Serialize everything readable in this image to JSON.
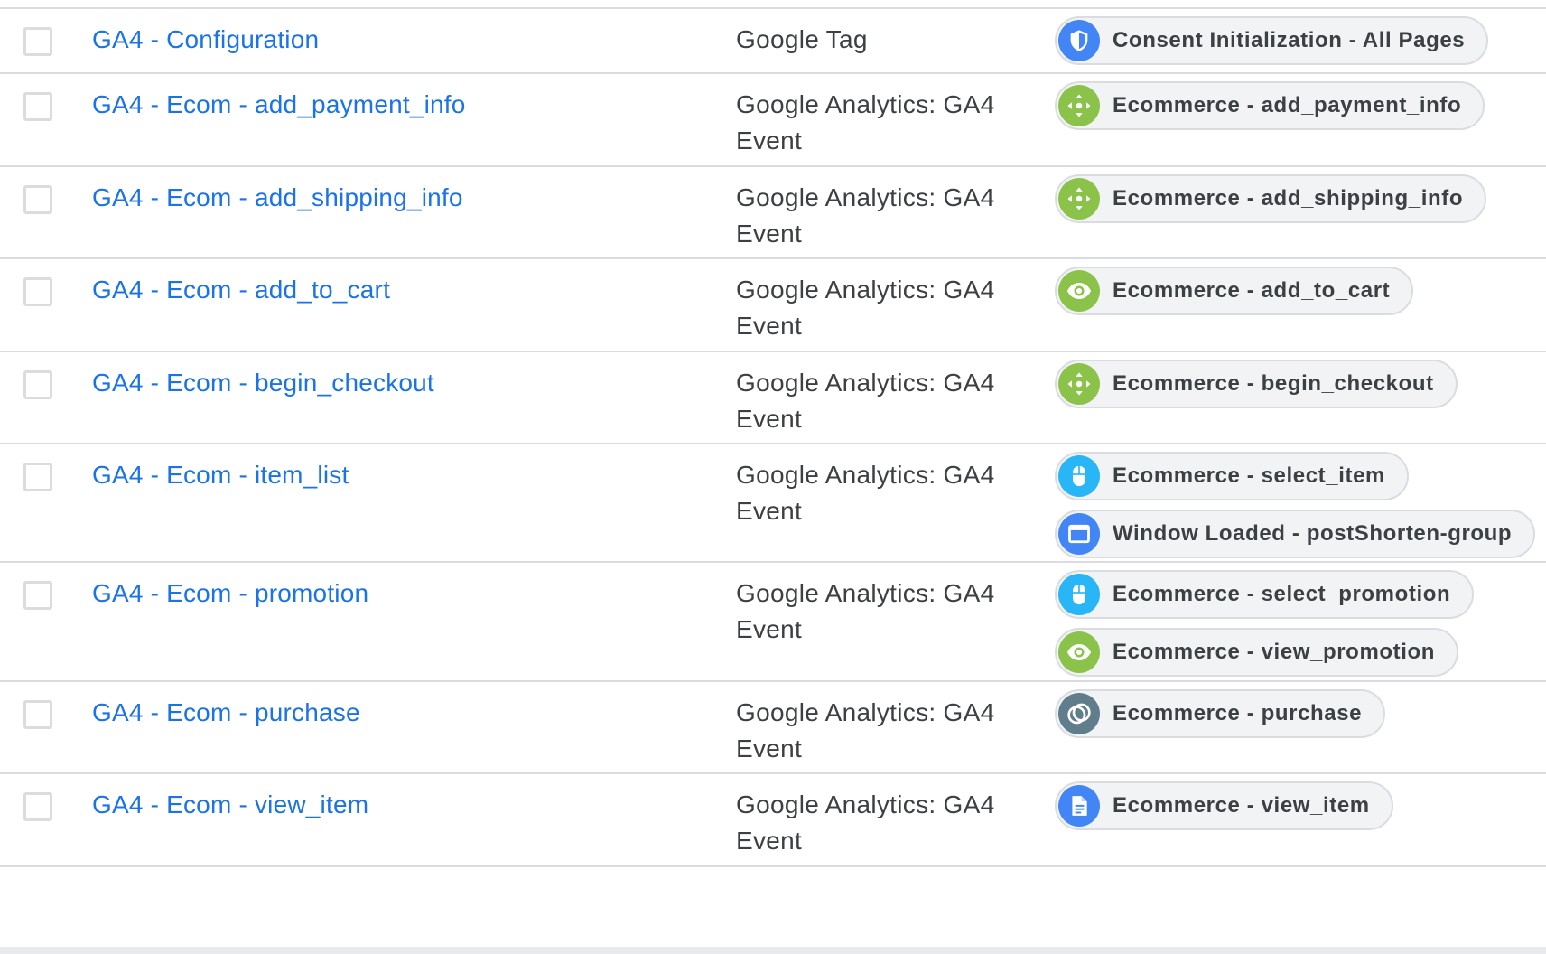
{
  "colors": {
    "link": "#1a73e8",
    "text": "#3c4043",
    "border": "#dadce0",
    "chip_bg": "#f1f3f4",
    "icon_blue": "#4285f4",
    "icon_green": "#8bc34a",
    "icon_lightblue": "#29b6f6",
    "icon_gray": "#607d8b"
  },
  "tags": [
    {
      "name": "GA4 - Configuration",
      "type": "Google Tag",
      "triggers": [
        {
          "label": "Consent Initialization - All Pages",
          "icon": "consent-shield-icon"
        }
      ]
    },
    {
      "name": "GA4 - Ecom - add_payment_info",
      "type": "Google Analytics: GA4 Event",
      "triggers": [
        {
          "label": "Ecommerce - add_payment_info",
          "icon": "custom-event-icon"
        }
      ]
    },
    {
      "name": "GA4 - Ecom - add_shipping_info",
      "type": "Google Analytics: GA4 Event",
      "triggers": [
        {
          "label": "Ecommerce - add_shipping_info",
          "icon": "custom-event-icon"
        }
      ]
    },
    {
      "name": "GA4 - Ecom - add_to_cart",
      "type": "Google Analytics: GA4 Event",
      "triggers": [
        {
          "label": "Ecommerce - add_to_cart",
          "icon": "eye-visibility-icon"
        }
      ]
    },
    {
      "name": "GA4 - Ecom - begin_checkout",
      "type": "Google Analytics: GA4 Event",
      "triggers": [
        {
          "label": "Ecommerce - begin_checkout",
          "icon": "custom-event-icon"
        }
      ]
    },
    {
      "name": "GA4 - Ecom - item_list",
      "type": "Google Analytics: GA4 Event",
      "triggers": [
        {
          "label": "Ecommerce - select_item",
          "icon": "mouse-click-icon"
        },
        {
          "label": "Window Loaded - postShorten-group",
          "icon": "window-icon"
        }
      ]
    },
    {
      "name": "GA4 - Ecom - promotion",
      "type": "Google Analytics: GA4 Event",
      "triggers": [
        {
          "label": "Ecommerce - select_promotion",
          "icon": "mouse-click-icon"
        },
        {
          "label": "Ecommerce - view_promotion",
          "icon": "eye-visibility-icon"
        }
      ]
    },
    {
      "name": "GA4 - Ecom - purchase",
      "type": "Google Analytics: GA4 Event",
      "triggers": [
        {
          "label": "Ecommerce - purchase",
          "icon": "trigger-group-icon"
        }
      ]
    },
    {
      "name": "GA4 - Ecom - view_item",
      "type": "Google Analytics: GA4 Event",
      "triggers": [
        {
          "label": "Ecommerce - view_item",
          "icon": "page-view-icon"
        }
      ]
    }
  ]
}
